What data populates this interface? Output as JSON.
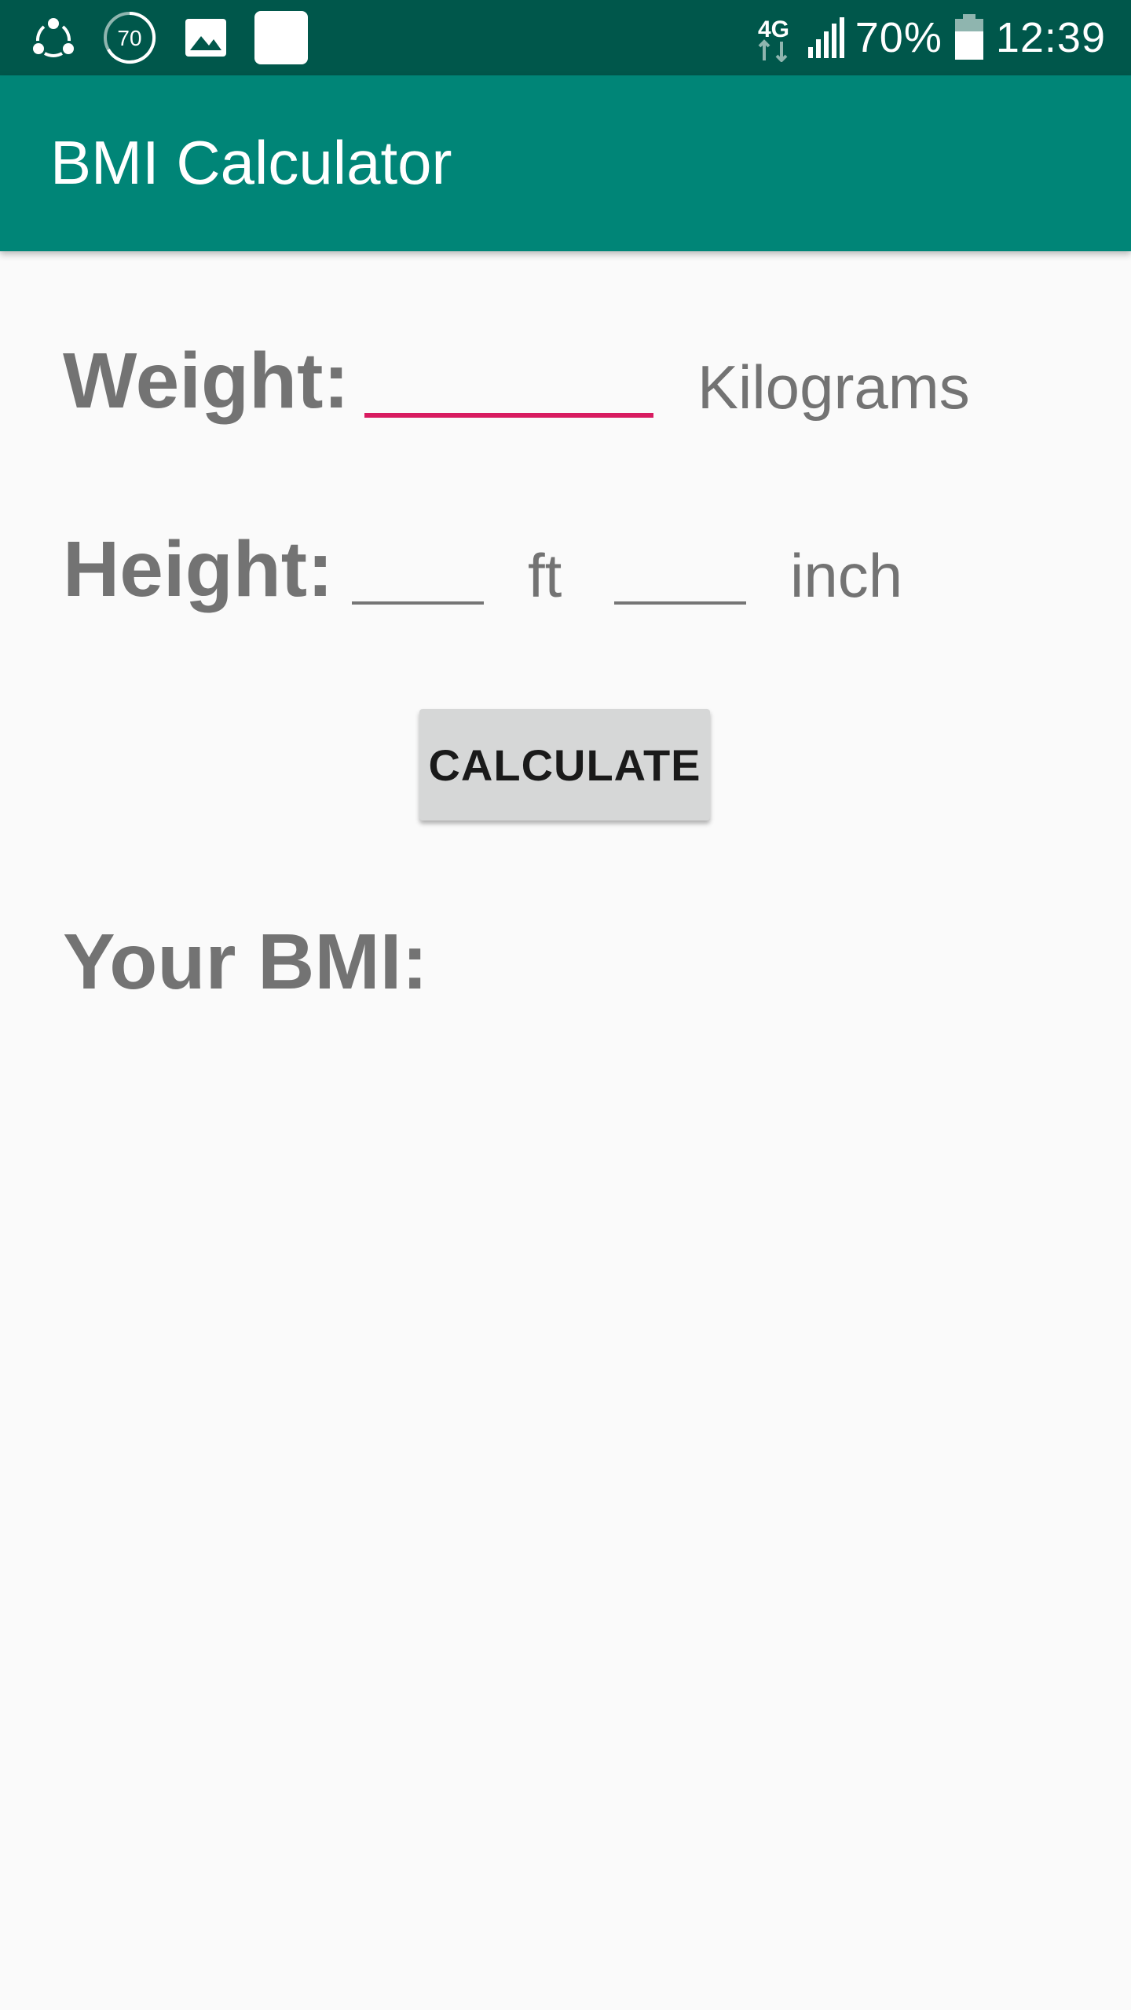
{
  "status_bar": {
    "icons_left": [
      "sync-icon",
      "data-usage-icon",
      "gallery-icon",
      "app-icon"
    ],
    "data_usage_badge": "70",
    "network": "4G",
    "battery_percent": "70%",
    "time": "12:39",
    "bg_color": "#00574b"
  },
  "app_bar": {
    "title": "BMI Calculator",
    "bg_color": "#008577"
  },
  "form": {
    "weight_label": "Weight:",
    "weight_value": "",
    "weight_unit": "Kilograms",
    "height_label": "Height:",
    "feet_value": "",
    "feet_unit": "ft",
    "inch_value": "",
    "inch_unit": "inch",
    "calculate_label": "CALCULATE",
    "result_label": "Your BMI:",
    "result_value": ""
  },
  "colors": {
    "accent": "#d81b60",
    "label": "#737373",
    "background": "#fafafa"
  }
}
